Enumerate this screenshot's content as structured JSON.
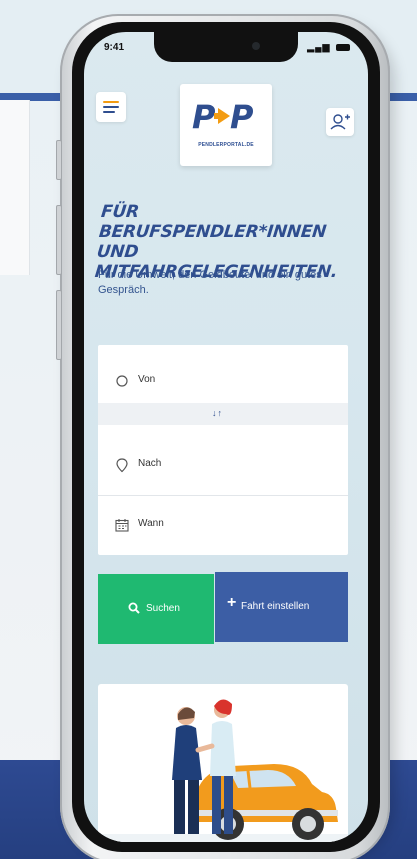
{
  "status_bar": {
    "time": "9:41",
    "icons": "..ıl ᯤ"
  },
  "logo": {
    "mark": "P▸P",
    "subtitle": "PENDLERPORTAL.DE"
  },
  "hero": {
    "title": "FÜR BERUFSPENDLER*INNEN UND MITFAHRGELEGENHEITEN.",
    "subtitle": "Für die Umwelt, den Geldbeutel und ein gutes Gespräch."
  },
  "form": {
    "from_label": "Von",
    "swap": "↓↑",
    "to_label": "Nach",
    "when_label": "Wann"
  },
  "actions": {
    "search_label": "Suchen",
    "offer_label": "Fahrt einstellen"
  },
  "icons": [
    "menu-icon",
    "user-add-icon",
    "circle-icon",
    "location-pin-icon",
    "calendar-icon",
    "search-icon",
    "plus-icon"
  ],
  "colors": {
    "brand_blue": "#2f4e8f",
    "brand_orange": "#f39c12",
    "search_green": "#1fb971",
    "offer_blue": "#3c5ea5"
  }
}
